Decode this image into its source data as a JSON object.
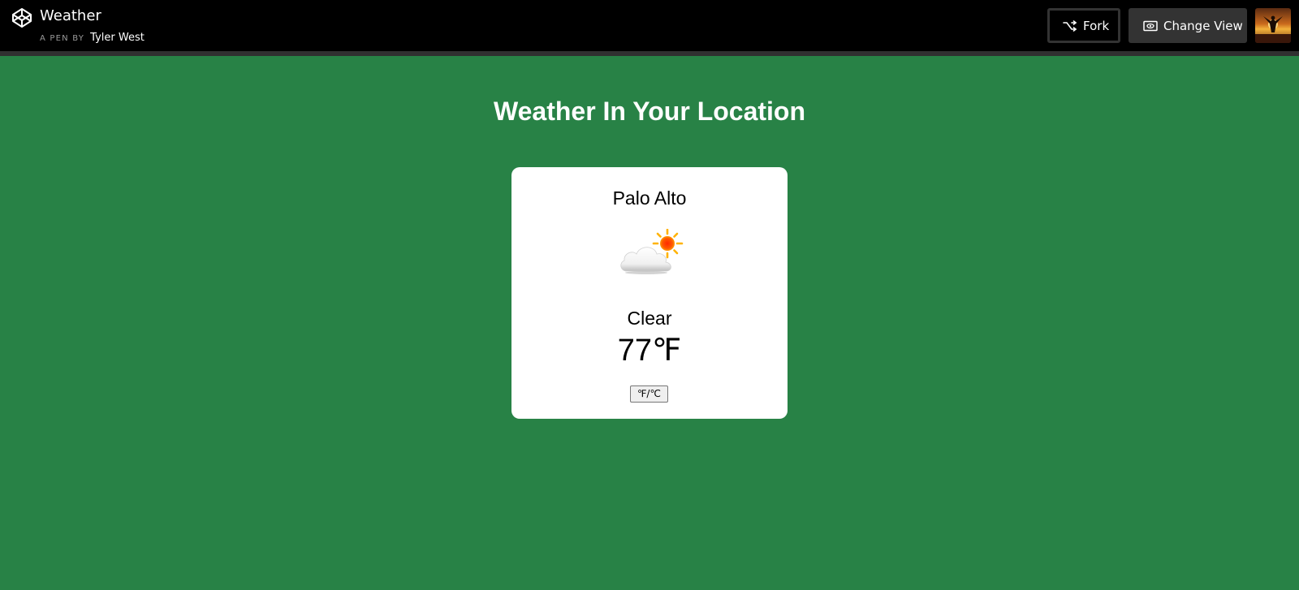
{
  "header": {
    "title": "Weather",
    "by_prefix": "A PEN BY",
    "author": "Tyler West",
    "fork_label": "Fork",
    "change_view_label": "Change View",
    "icons": {
      "logo": "codepen-logo-icon",
      "fork": "fork-icon",
      "change_view": "eye-icon",
      "avatar": "user-avatar"
    }
  },
  "main": {
    "heading": "Weather In Your Location",
    "card": {
      "city": "Palo Alto",
      "weather_icon": "partly-cloudy-icon",
      "condition": "Clear",
      "temperature": "77℉",
      "toggle_label": "℉/℃"
    }
  },
  "colors": {
    "background": "#288246",
    "topbar": "#000000",
    "card": "#ffffff",
    "button_dark": "#333333"
  }
}
